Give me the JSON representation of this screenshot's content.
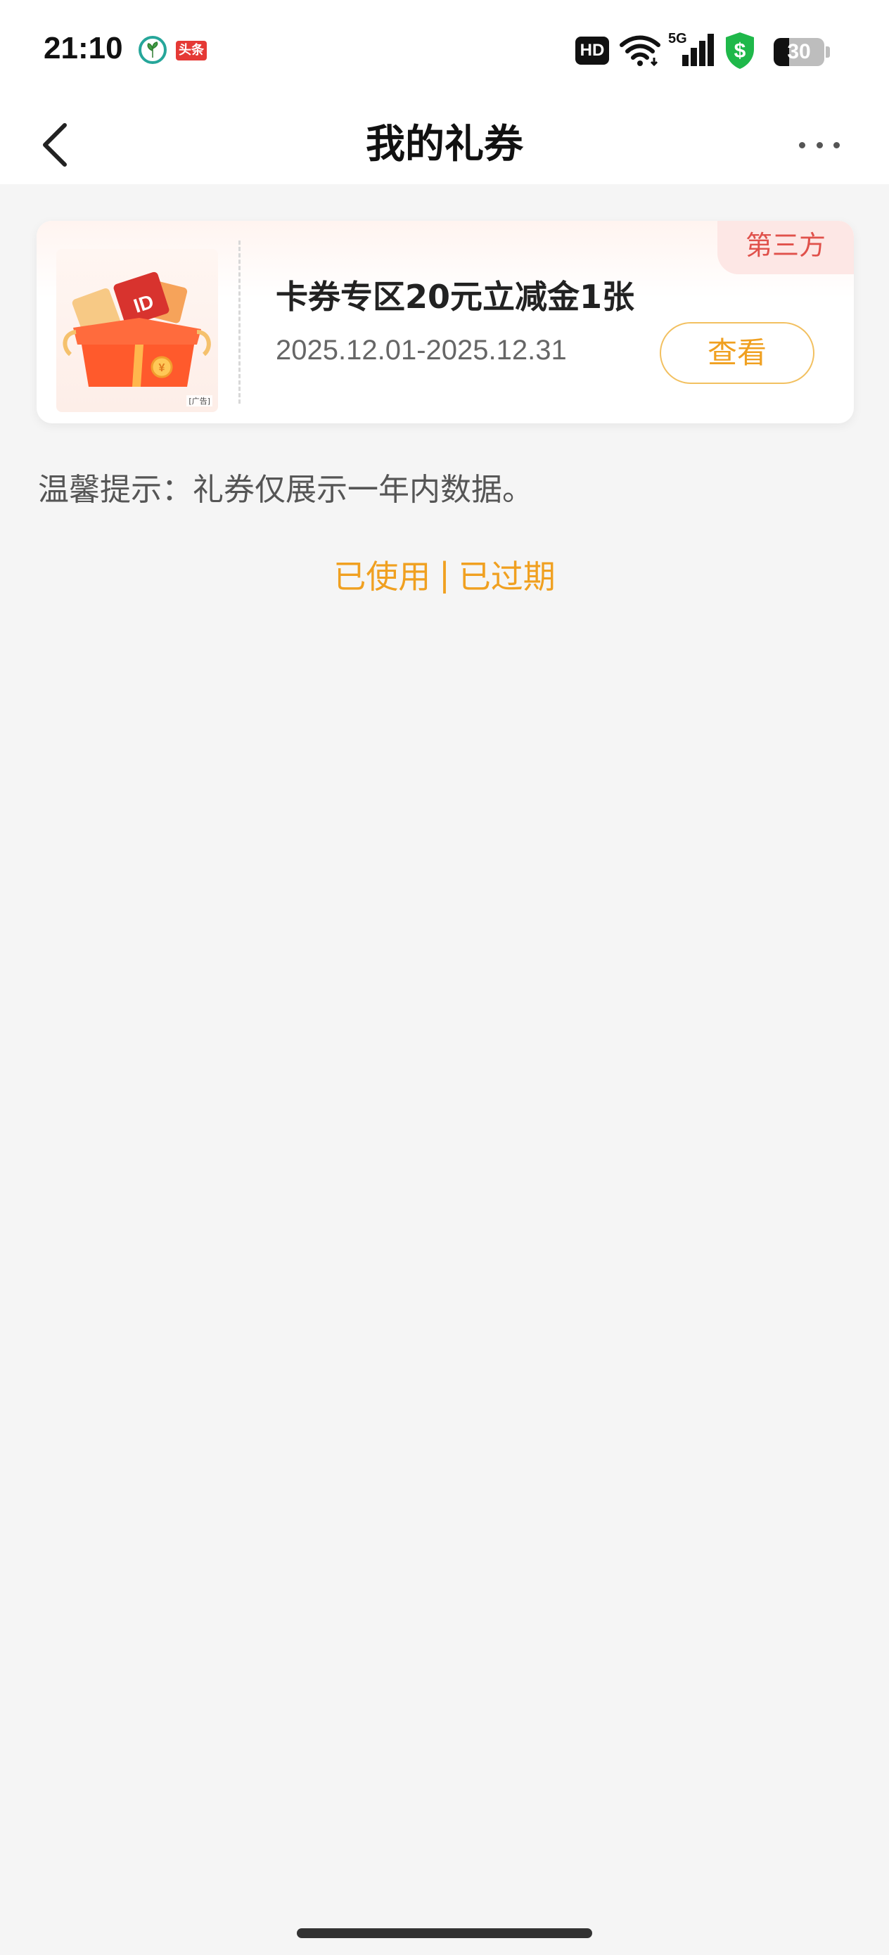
{
  "status_bar": {
    "time": "21:10",
    "app_icons": [
      "plant-app-icon",
      "toutiao-app-icon"
    ],
    "app2_label": "头条",
    "hd_label": "HD",
    "network_label": "5G",
    "battery_level": "30",
    "battery_fraction": 0.3,
    "shield_symbol": "$"
  },
  "nav": {
    "back_icon": "chevron-left-icon",
    "title": "我的礼券",
    "more_icon": "more-dots-icon"
  },
  "coupon": {
    "tag": "第三方",
    "title": "卡券专区20元立减金1张",
    "date_range": "2025.12.01-2025.12.31",
    "action_label": "查看",
    "image_ad_label": "[广告]",
    "colors": {
      "tag_bg": "#fde7e5",
      "tag_text": "#e0514b",
      "button_border": "#f2c060",
      "button_text": "#f0a020"
    }
  },
  "tip_text": "温馨提示：礼券仅展示一年内数据。",
  "links": {
    "used": "已使用",
    "separator": "|",
    "expired": "已过期",
    "color": "#f0a020"
  }
}
